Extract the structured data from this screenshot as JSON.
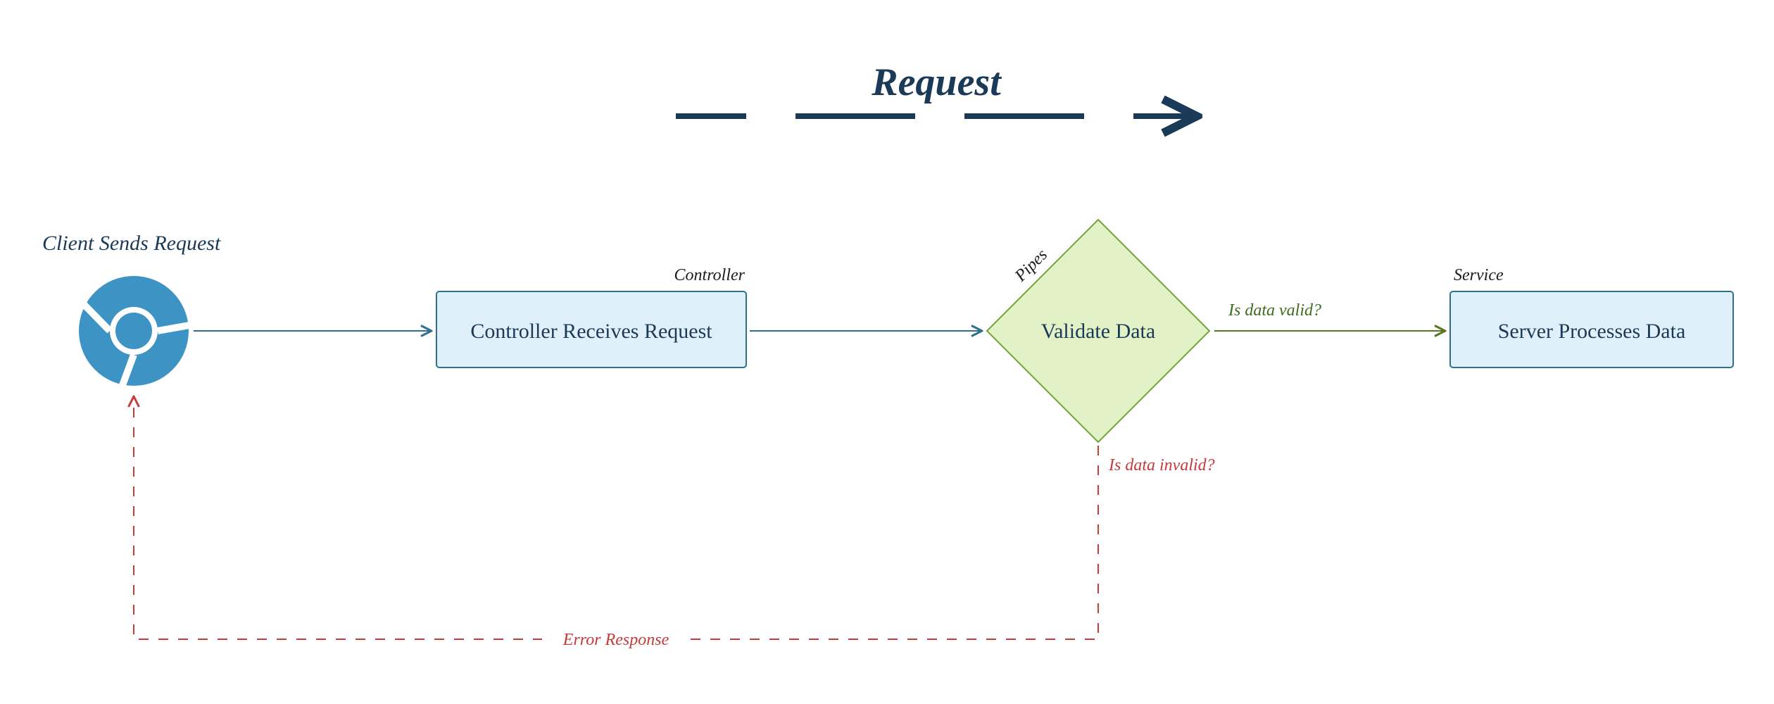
{
  "title": "Request",
  "nodes": {
    "client": {
      "label": "Client Sends Request"
    },
    "controller": {
      "label": "Controller Receives Request",
      "tag": "Controller"
    },
    "pipes": {
      "label": "Validate Data",
      "tag": "Pipes"
    },
    "service": {
      "label": "Server Processes Data",
      "tag": "Service"
    }
  },
  "edges": {
    "valid": "Is data valid?",
    "invalid": "Is data invalid?",
    "error": "Error Response"
  },
  "colors": {
    "blueNode": "#dff0fb",
    "blueStroke": "#2f6f8f",
    "greenNode": "#e3f1c6",
    "greenStroke": "#74a33a",
    "navy": "#1b3a57",
    "red": "#c63a3a",
    "greenText": "#3d6b1f"
  }
}
